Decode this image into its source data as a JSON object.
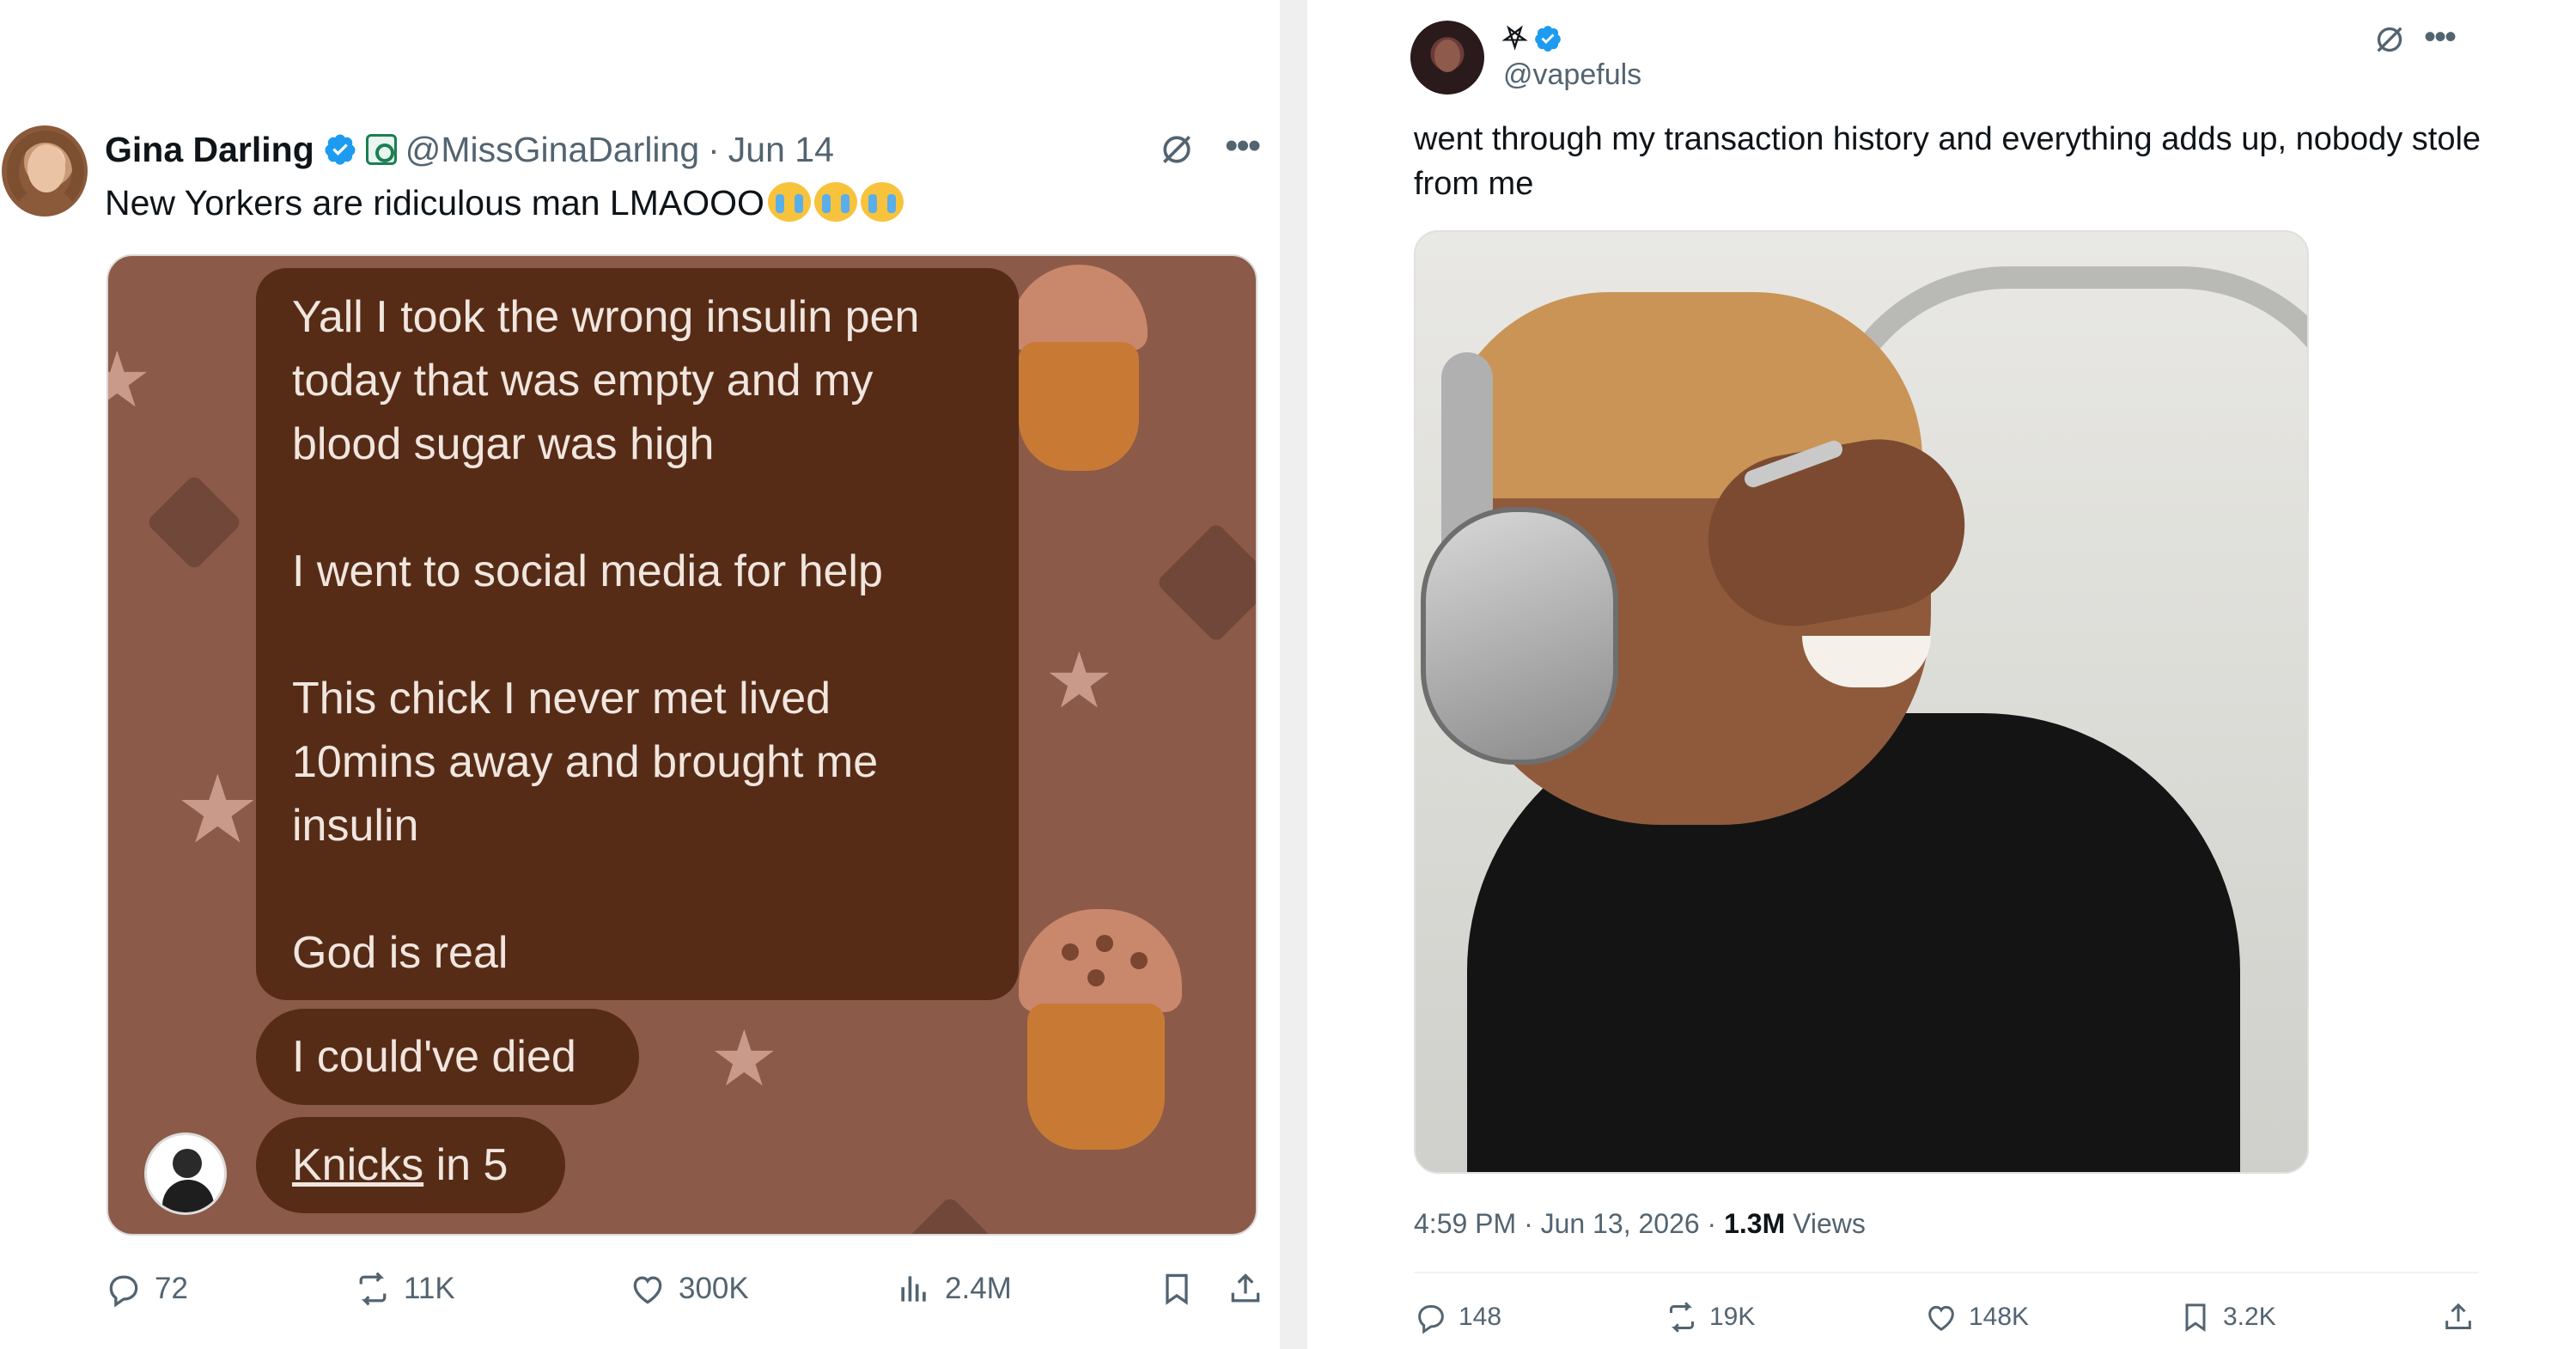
{
  "left_tweet": {
    "author_name": "Gina Darling",
    "handle": "@MissGinaDarling",
    "date_sep": "·",
    "date": "Jun 14",
    "text": "New Yorkers are ridiculous man LMAOOO",
    "emojis": [
      "loudly-crying-face",
      "loudly-crying-face",
      "loudly-crying-face"
    ],
    "media": {
      "message_main": [
        "Yall I took the wrong insulin pen today that was empty and my blood sugar was high",
        "I went to social media for help",
        "This chick I never met lived 10mins away and brought me insulin",
        "God is real"
      ],
      "message_2": "I could've died",
      "message_3_link": "Knicks",
      "message_3_rest": " in 5"
    },
    "actions": {
      "replies": "72",
      "reposts": "11K",
      "likes": "300K",
      "views": "2.4M"
    },
    "colors": {
      "verified": "#1d9bf0",
      "affiliate": "#1a7f52"
    }
  },
  "right_tweet": {
    "author_name": "⛧",
    "handle": "@vapefuls",
    "text": "went through my transaction history and everything adds up, nobody stole from me",
    "meta": {
      "time": "4:59 PM",
      "sep1": " · ",
      "date": "Jun 13, 2026",
      "sep2": " · ",
      "views_count": "1.3M",
      "views_label": " Views"
    },
    "actions": {
      "replies": "148",
      "reposts": "19K",
      "likes": "148K",
      "bookmarks": "3.2K"
    }
  }
}
